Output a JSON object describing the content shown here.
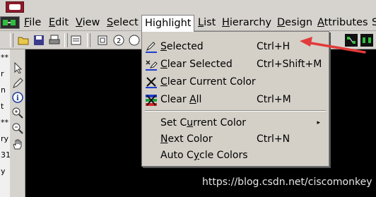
{
  "menubar": {
    "items": [
      {
        "label": "File",
        "ul": "F",
        "rest": "ile"
      },
      {
        "label": "Edit",
        "ul": "E",
        "rest": "dit"
      },
      {
        "label": "View",
        "ul": "V",
        "rest": "iew"
      },
      {
        "label": "Select",
        "ul": "S",
        "rest": "elect"
      },
      {
        "label": "Highlight",
        "ul": "",
        "rest": "Highlight"
      },
      {
        "label": "List",
        "ul": "L",
        "rest": "ist"
      },
      {
        "label": "Hierarchy",
        "ul": "H",
        "rest": "ierarchy"
      },
      {
        "label": "Design",
        "ul": "D",
        "rest": "esign"
      },
      {
        "label": "Attributes",
        "ul": "A",
        "rest": "ttributes"
      },
      {
        "label": "S",
        "ul": "",
        "rest": "S"
      }
    ]
  },
  "highlight_menu": {
    "items": [
      {
        "pre": "",
        "ul": "S",
        "post": "elected",
        "shortcut": "Ctrl+H",
        "icon": "pencil-icon"
      },
      {
        "pre": "",
        "ul": "C",
        "post": "lear Selected",
        "shortcut": "Ctrl+Shift+M",
        "icon": "clear-pencil-icon"
      },
      {
        "pre": "",
        "ul": "C",
        "post": "lear Current Color",
        "shortcut": "",
        "icon": "clear-x-icon"
      },
      {
        "pre": "Clear ",
        "ul": "A",
        "post": "ll",
        "shortcut": "Ctrl+M",
        "icon": "clear-all-icon"
      },
      {
        "pre": "Set C",
        "ul": "u",
        "post": "rrent Color",
        "shortcut": "",
        "icon": "",
        "submenu": "▸"
      },
      {
        "pre": "",
        "ul": "N",
        "post": "ext Color",
        "shortcut": "Ctrl+N",
        "icon": ""
      },
      {
        "pre": "Auto C",
        "ul": "y",
        "post": "cle Colors",
        "shortcut": "",
        "icon": ""
      }
    ]
  },
  "side_text": [
    "**",
    "r",
    "n",
    "t",
    "**",
    "ry",
    "31",
    "y"
  ],
  "watermark": "https://blog.csdn.net/ciscomonkey",
  "colors": {
    "accent_arrow": "#e23a3a",
    "menu_bg": "#d4d0c8",
    "canvas": "#000000"
  }
}
